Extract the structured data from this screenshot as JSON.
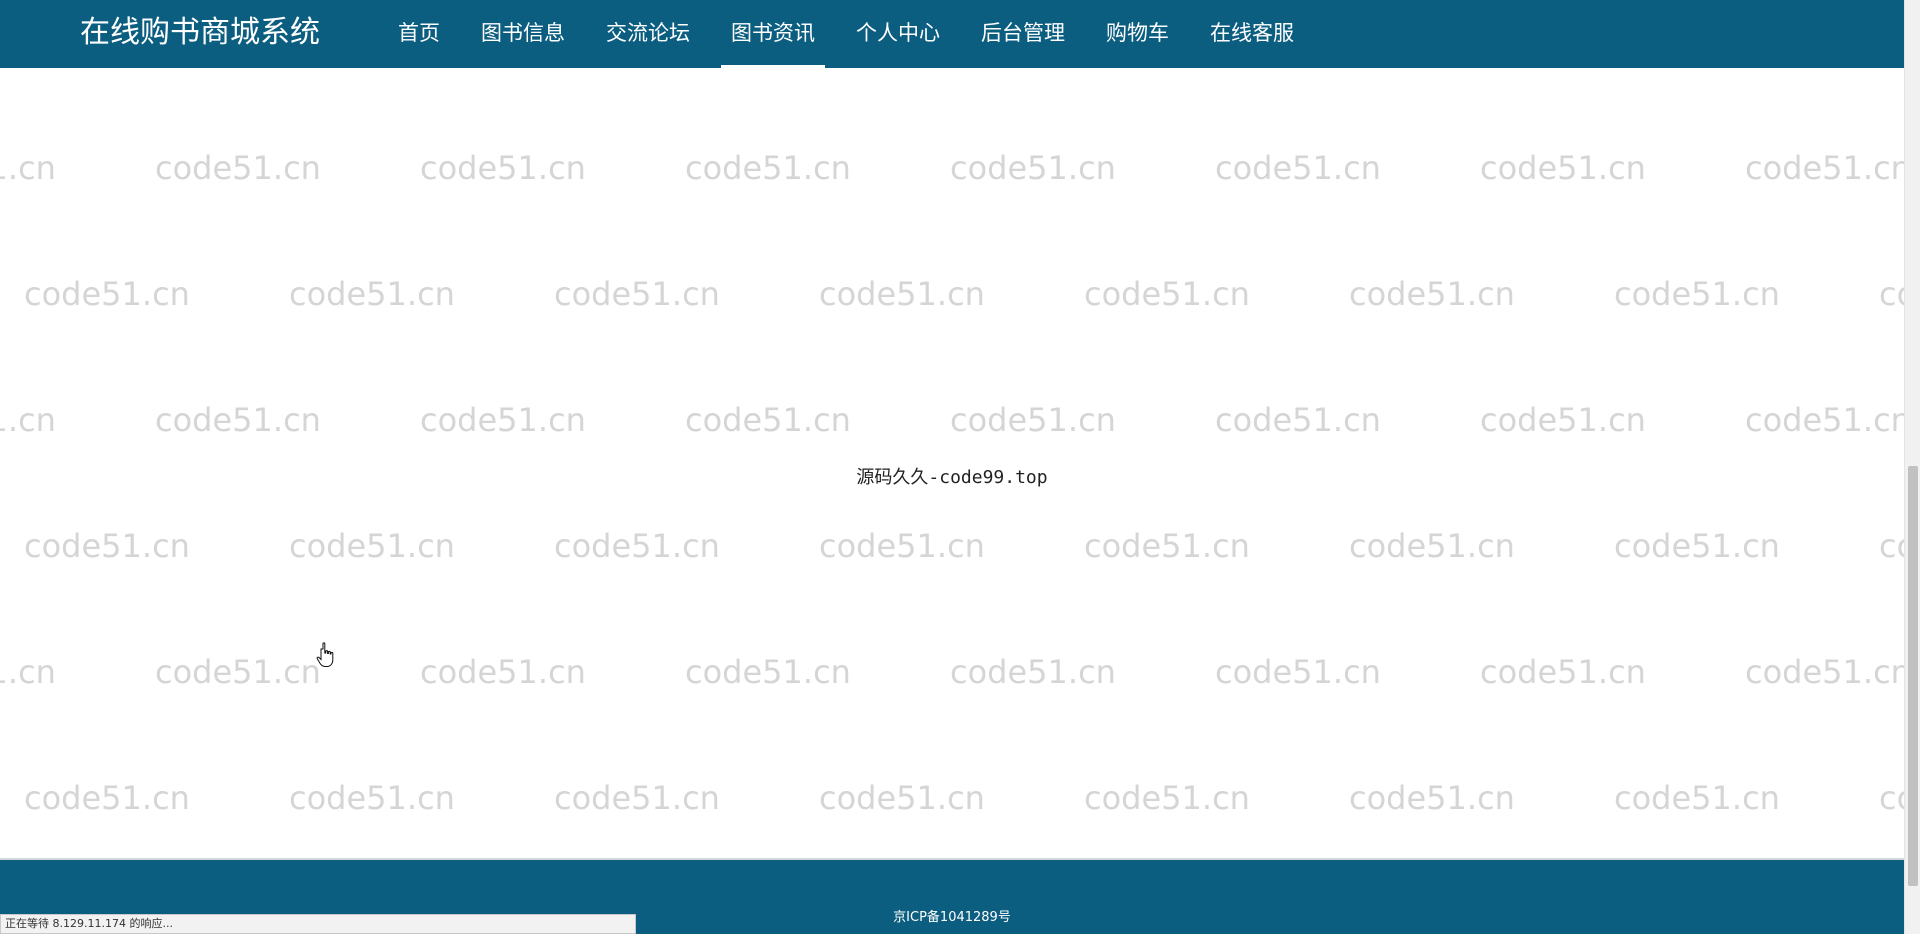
{
  "header": {
    "brand": "在线购书商城系统",
    "nav": [
      {
        "label": "首页",
        "active": false
      },
      {
        "label": "图书信息",
        "active": false
      },
      {
        "label": "交流论坛",
        "active": false
      },
      {
        "label": "图书资讯",
        "active": true
      },
      {
        "label": "个人中心",
        "active": false
      },
      {
        "label": "后台管理",
        "active": false
      },
      {
        "label": "购物车",
        "active": false
      },
      {
        "label": "在线客服",
        "active": false
      }
    ]
  },
  "watermark_text": "code51.cn",
  "main": {
    "center_text": "源码久久-code99.top"
  },
  "footer": {
    "icp": "京ICP备1041289号"
  },
  "browser": {
    "status": "正在等待 8.129.11.174 的响应..."
  },
  "colors": {
    "header_bg": "#0b5e80",
    "footer_bg": "#0b5e80",
    "watermark": "#d5d5d5"
  },
  "icons": {
    "cursor": "hand-pointer-icon"
  }
}
